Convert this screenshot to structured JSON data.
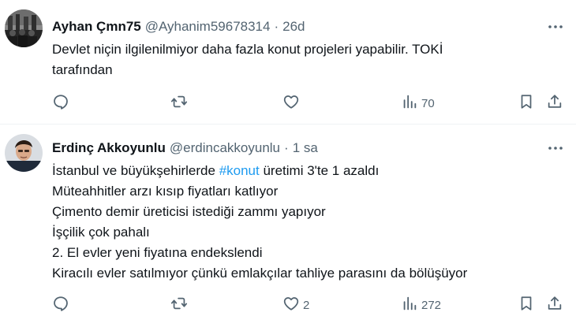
{
  "tweets": [
    {
      "display_name": "Ayhan Çmn75",
      "handle": "@Ayhanim59678314",
      "separator": "·",
      "time": "26d",
      "lines": [
        "Devlet niçin ilgilenilmiyor daha fazla konut projeleri yapabilir. TOKİ",
        "tarafından"
      ],
      "actions": {
        "reply": "",
        "retweet": "",
        "like": "",
        "views": "70"
      }
    },
    {
      "display_name": "Erdinç Akkoyunlu",
      "handle": "@erdincakkoyunlu",
      "separator": "·",
      "time": "1 sa",
      "first_line": {
        "before": "İstanbul ve büyükşehirlerde ",
        "hashtag": "#konut",
        "after": " üretimi 3'te 1 azaldı"
      },
      "lines": [
        "Müteahhitler arzı kısıp fiyatları katlıyor",
        "Çimento demir üreticisi istediği zammı yapıyor",
        "İşçilik çok pahalı",
        "2. El evler yeni fiyatına endekslendi",
        "Kiracılı evler satılmıyor çünkü emlakçılar tahliye parasını da bölüşüyor"
      ],
      "actions": {
        "reply": "",
        "retweet": "",
        "like": "2",
        "views": "272"
      }
    }
  ],
  "colors": {
    "text": "#0f1419",
    "secondary": "#536471",
    "link": "#1d9bf0",
    "divider": "#eff3f4"
  },
  "icons": [
    "more-icon",
    "reply-icon",
    "retweet-icon",
    "like-icon",
    "views-icon",
    "bookmark-icon",
    "share-icon"
  ]
}
